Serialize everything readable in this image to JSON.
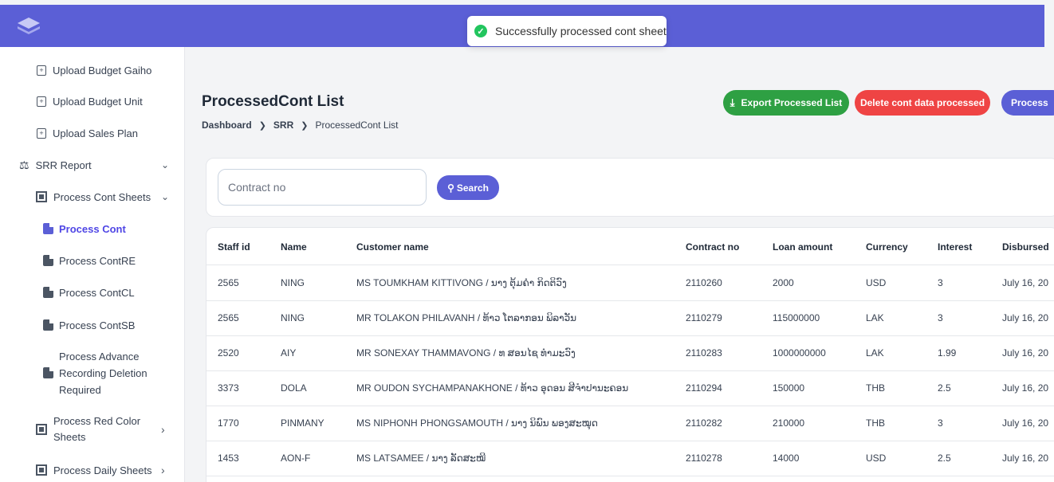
{
  "toast": {
    "message": "Successfully processed cont sheet"
  },
  "sidebar": {
    "upload_budget_gaiho": "Upload Budget Gaiho",
    "upload_budget_unit": "Upload Budget Unit",
    "upload_sales_plan": "Upload Sales Plan",
    "srr_report": "SRR Report",
    "process_cont_sheets": "Process Cont Sheets",
    "process_cont": "Process Cont",
    "process_contre": "Process ContRE",
    "process_contcl": "Process ContCL",
    "process_contsb": "Process ContSB",
    "process_advance_1": "Process Advance",
    "process_advance_2": "Recording Deletion",
    "process_advance_3": "Required",
    "process_red_1": "Process Red Color",
    "process_red_2": "Sheets",
    "process_daily_sheets": "Process Daily Sheets"
  },
  "header": {
    "title": "ProcessedCont List",
    "breadcrumb": [
      "Dashboard",
      "SRR",
      "ProcessedCont List"
    ],
    "export_label": "Export Processed List",
    "delete_label": "Delete cont data processed",
    "process_label": "Process"
  },
  "search": {
    "placeholder": "Contract no",
    "button_label": "Search"
  },
  "table": {
    "columns": [
      "Staff id",
      "Name",
      "Customer name",
      "Contract no",
      "Loan amount",
      "Currency",
      "Interest",
      "Disbursed"
    ],
    "rows": [
      [
        "2565",
        "NING",
        "MS TOUMKHAM KITTIVONG / ນາງ ຕຸ້ມຄຳ ກິດຕິວົງ",
        "2110260",
        "2000",
        "USD",
        "3",
        "July 16, 20"
      ],
      [
        "2565",
        "NING",
        "MR TOLAKON PHILAVANH / ທ້າວ ໂຕລາກອນ ພິລາວັນ",
        "2110279",
        "115000000",
        "LAK",
        "3",
        "July 16, 20"
      ],
      [
        "2520",
        "AIY",
        "MR SONEXAY THAMMAVONG / ທ ສອນໄຊ ທຳມະວົງ",
        "2110283",
        "1000000000",
        "LAK",
        "1.99",
        "July 16, 20"
      ],
      [
        "3373",
        "DOLA",
        "MR OUDON SYCHAMPANAKHONE / ທ້າວ ອຸດອນ ສີຈຳປານະຄອນ",
        "2110294",
        "150000",
        "THB",
        "2.5",
        "July 16, 20"
      ],
      [
        "1770",
        "PINMANY",
        "MS NIPHONH PHONGSAMOUTH / ນາງ ນິພົນ ພອງສະໝຸດ",
        "2110282",
        "210000",
        "THB",
        "3",
        "July 16, 20"
      ],
      [
        "1453",
        "AON-F",
        "MS LATSAMEE / ນາງ ລັດສະໝີ",
        "2110278",
        "14000",
        "USD",
        "2.5",
        "July 16, 20"
      ]
    ]
  },
  "colors": {
    "primary": "#5b5fd6",
    "success": "#2ea043",
    "danger": "#ef4444"
  }
}
